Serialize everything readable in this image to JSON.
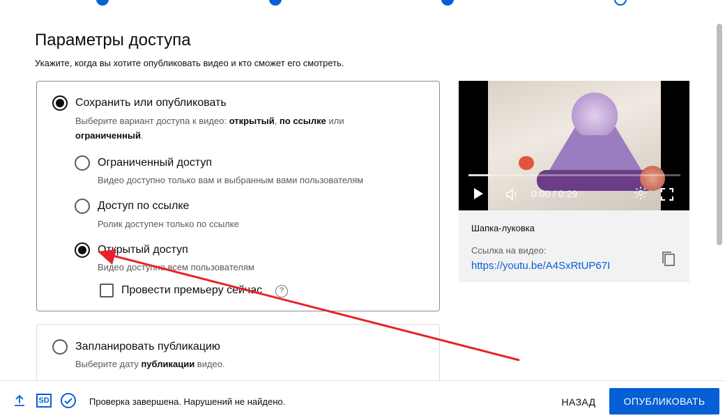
{
  "page": {
    "title": "Параметры доступа",
    "subtitle": "Укажите, когда вы хотите опубликовать видео и кто сможет его смотреть."
  },
  "save_publish": {
    "label": "Сохранить или опубликовать",
    "desc_prefix": "Выберите вариант доступа к видео: ",
    "desc_opt1": "открытый",
    "desc_sep": ", ",
    "desc_opt2": "по ссылке",
    "desc_or": " или ",
    "desc_opt3": "ограниченный",
    "desc_end": ".",
    "options": [
      {
        "label": "Ограниченный доступ",
        "desc": "Видео доступно только вам и выбранным вами пользователям",
        "selected": false
      },
      {
        "label": "Доступ по ссылке",
        "desc": "Ролик доступен только по ссылке",
        "selected": false
      },
      {
        "label": "Открытый доступ",
        "desc": "Видео доступно всем пользователям",
        "selected": true
      }
    ],
    "premiere_label": "Провести премьеру сейчас",
    "help_glyph": "?"
  },
  "schedule": {
    "label": "Запланировать публикацию",
    "desc_prefix": "Выберите дату ",
    "desc_bold": "публикации",
    "desc_suffix": " видео."
  },
  "preview": {
    "time": "0:00 / 0:29",
    "progress": 0.1,
    "video_title": "Шапка-луковка",
    "link_label": "Ссылка на видео:",
    "link": "https://youtu.be/A4SxRtUP67I"
  },
  "footer": {
    "status": "Проверка завершена. Нарушений не найдено.",
    "sd_badge": "SD",
    "back": "НАЗАД",
    "publish": "ОПУБЛИКОВАТЬ"
  },
  "colors": {
    "accent": "#065fd4",
    "annotation_arrow": "#e8222a"
  }
}
